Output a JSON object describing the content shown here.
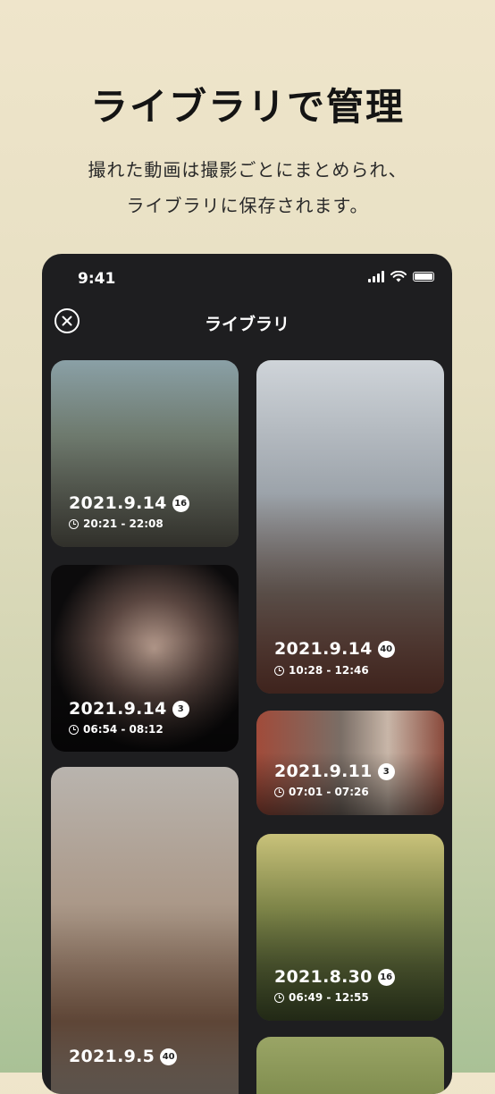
{
  "headline": "ライブラリで管理",
  "subtitle_line1": "撮れた動画は撮影ごとにまとめられ、",
  "subtitle_line2": "ライブラリに保存されます。",
  "phone": {
    "status_time": "9:41",
    "nav_title": "ライブラリ",
    "cards": [
      {
        "date": "2021.9.14",
        "count": "16",
        "time": "20:21 - 22:08",
        "bg": "#6b7b7e"
      },
      {
        "date": "2021.9.14",
        "count": "40",
        "time": "10:28 - 12:46",
        "bg": "#8a8c93"
      },
      {
        "date": "2021.9.14",
        "count": "3",
        "time": "06:54 - 08:12",
        "bg": "#1a1616"
      },
      {
        "date": "2021.9.11",
        "count": "3",
        "time": "07:01 - 07:26",
        "bg": "#7d5a4f"
      },
      {
        "date": "2021.9.5",
        "count": "40",
        "time": "",
        "bg": "#8c817a"
      },
      {
        "date": "2021.8.30",
        "count": "16",
        "time": "06:49 - 12:55",
        "bg": "#6a7a3f"
      }
    ]
  }
}
